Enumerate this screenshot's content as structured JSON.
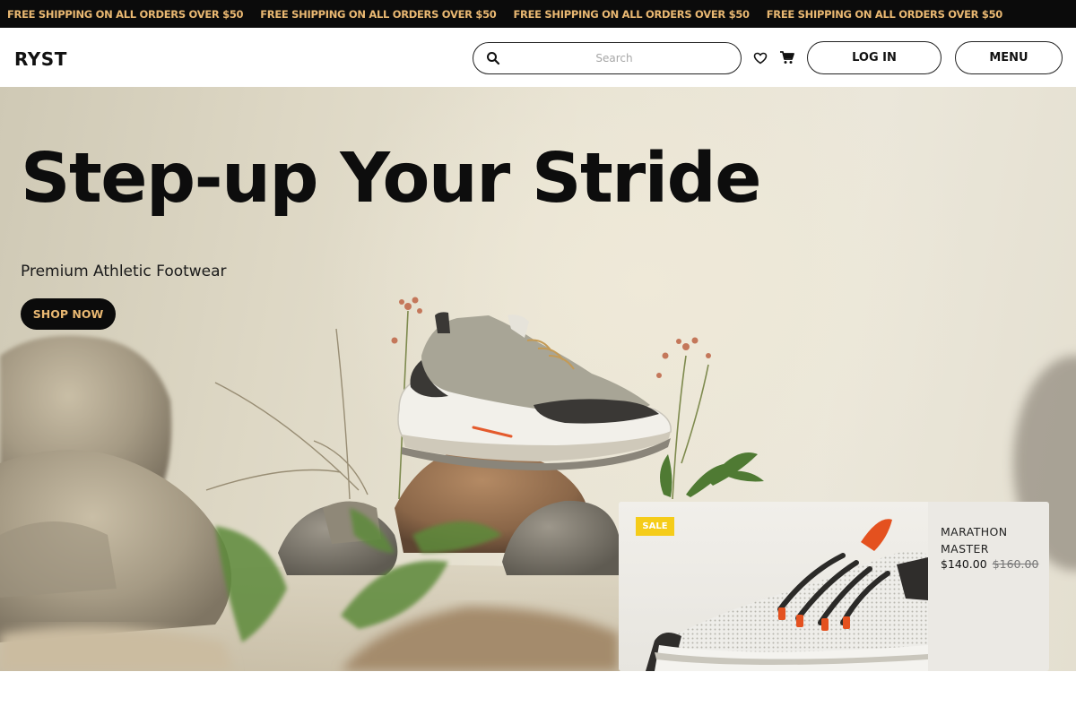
{
  "announcement": {
    "items": [
      "FREE SHIPPING ON ALL ORDERS OVER $50",
      "FREE SHIPPING ON ALL ORDERS OVER $50",
      "FREE SHIPPING ON ALL ORDERS OVER $50",
      "FREE SHIPPING ON ALL ORDERS OVER $50"
    ]
  },
  "header": {
    "logo": "RYST",
    "search_placeholder": "Search",
    "search_icon": "search-icon",
    "wishlist_icon": "heart-icon",
    "cart_icon": "cart-icon",
    "login_label": "LOG IN",
    "menu_label": "MENU"
  },
  "hero": {
    "title": "Step-up Your Stride",
    "subtitle": "Premium Athletic Footwear",
    "cta_label": "SHOP NOW"
  },
  "product_card": {
    "badge": "SALE",
    "name": "MARATHON MASTER",
    "price": "$140.00",
    "original_price": "$160.00"
  },
  "colors": {
    "announcement_bg": "#0b0b0b",
    "accent_gold": "#e9b872",
    "sale_badge": "#f5cc19",
    "text_dark": "#0d0d0d"
  }
}
